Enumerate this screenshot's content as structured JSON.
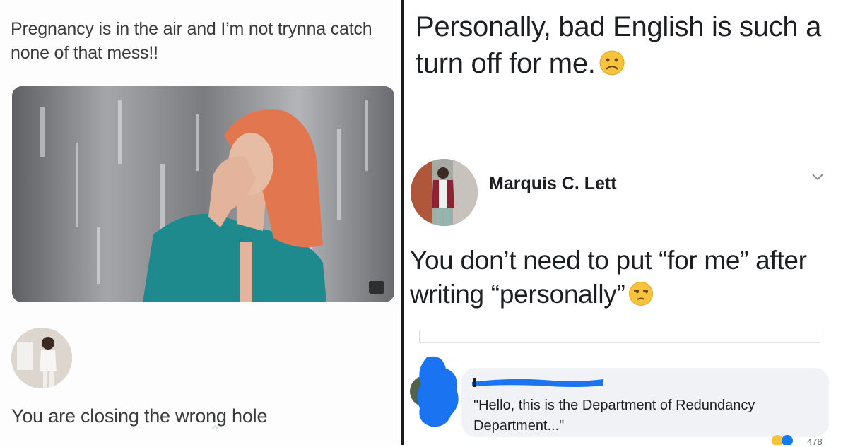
{
  "left_post": {
    "text": "Pregnancy is in the air and I’m not trynna catch none of that mess!!",
    "reply": "You are closing the wrong hole"
  },
  "right_post": {
    "text": "Personally, bad English is such a turn off for me.",
    "text_emoji": "frowning-face",
    "comment_author": "Marquis C. Lett",
    "comment_text": "You don’t need to put “for me” after writing “personally”",
    "comment_emoji": "unamused-face",
    "reply_text": "\"Hello, this is the Department of Redundancy Department...\""
  },
  "colors": {
    "divider": "#1b1b1b",
    "scribble_blue": "#1a73f0",
    "bubble": "#f0f2f5",
    "emoji_yellow": "#f7c23c"
  }
}
